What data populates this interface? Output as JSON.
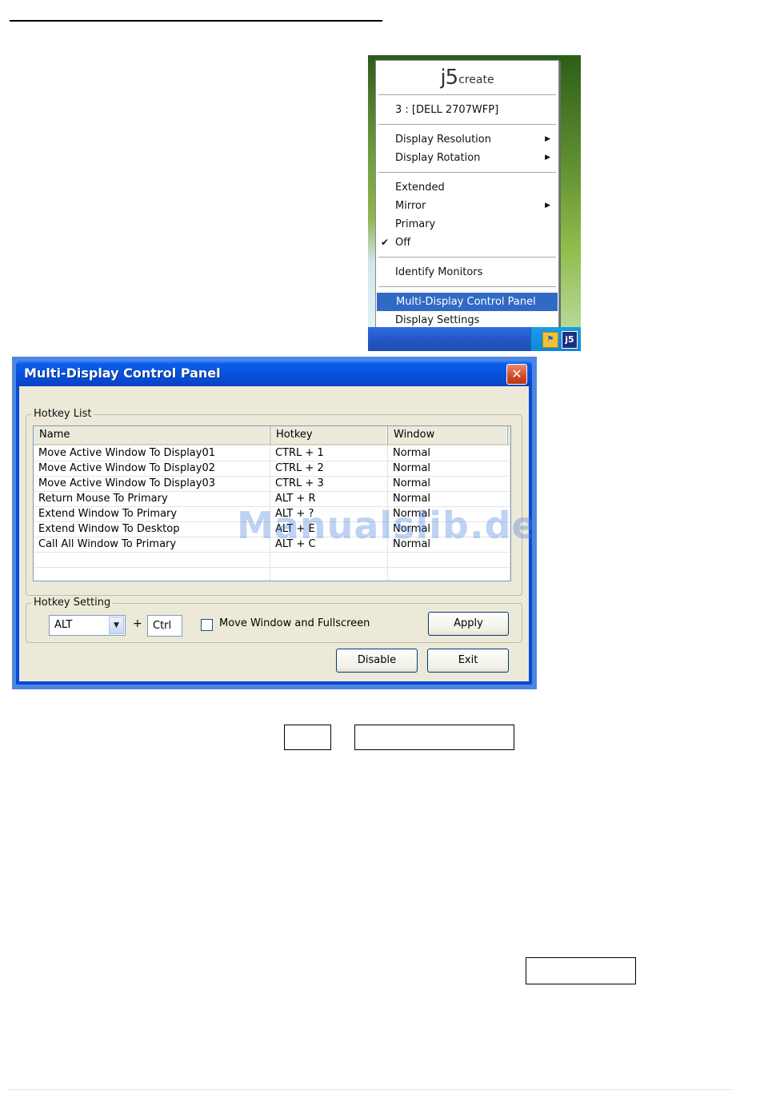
{
  "tray_menu": {
    "logo_j5": "j5",
    "logo_create": "create",
    "monitor": "3 : [DELL 2707WFP]",
    "items_group1": [
      {
        "label": "Display Resolution",
        "has_submenu": true
      },
      {
        "label": "Display Rotation",
        "has_submenu": true
      }
    ],
    "items_group2": [
      {
        "label": "Extended",
        "has_submenu": false,
        "checked": false
      },
      {
        "label": "Mirror",
        "has_submenu": true,
        "checked": false
      },
      {
        "label": "Primary",
        "has_submenu": false,
        "checked": false
      },
      {
        "label": "Off",
        "has_submenu": false,
        "checked": true
      }
    ],
    "identify": "Identify Monitors",
    "control_panel": "Multi-Display Control Panel",
    "display_settings": "Display Settings",
    "tray_icon_label": "j5"
  },
  "dialog": {
    "title": "Multi-Display Control Panel",
    "close_glyph": "✕",
    "hotkey_list_title": "Hotkey List",
    "columns": [
      "Name",
      "Hotkey",
      "Window"
    ],
    "rows": [
      [
        "Move Active Window To Display01",
        "CTRL + 1",
        "Normal"
      ],
      [
        "Move Active Window To Display02",
        "CTRL + 2",
        "Normal"
      ],
      [
        "Move Active Window To Display03",
        "CTRL + 3",
        "Normal"
      ],
      [
        "Return Mouse To Primary",
        "ALT + R",
        "Normal"
      ],
      [
        "Extend Window To Primary",
        "ALT + ?",
        "Normal"
      ],
      [
        "Extend Window To Desktop",
        "ALT + E",
        "Normal"
      ],
      [
        "Call All Window To Primary",
        "ALT + C",
        "Normal"
      ],
      [
        "",
        "",
        ""
      ],
      [
        "",
        "",
        ""
      ]
    ],
    "watermark": "Manualslib.de",
    "hotkey_setting_title": "Hotkey Setting",
    "modifier_value": "ALT",
    "plus": "+",
    "key_value": "Ctrl",
    "checkbox_label": "Move Window and Fullscreen",
    "checkbox_checked": false,
    "apply_label": "Apply",
    "disable_label": "Disable",
    "exit_label": "Exit"
  },
  "colors": {
    "titlebar": "#0653df",
    "selection": "#316ac5",
    "dialog_face": "#ece9d8"
  }
}
